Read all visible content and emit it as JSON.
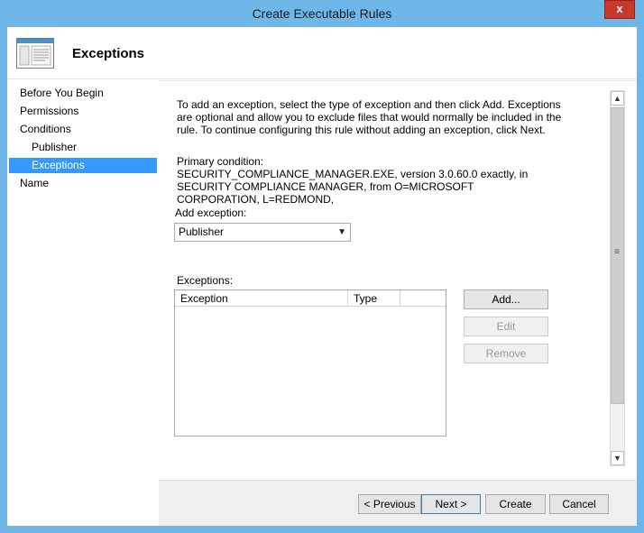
{
  "window": {
    "title": "Create Executable Rules",
    "close_glyph": "x"
  },
  "header": {
    "icon": "form-window-icon",
    "title": "Exceptions"
  },
  "nav": {
    "items": [
      {
        "label": "Before You Begin"
      },
      {
        "label": "Permissions"
      },
      {
        "label": "Conditions"
      },
      {
        "label": "Publisher"
      },
      {
        "label": "Exceptions"
      },
      {
        "label": "Name"
      }
    ],
    "selected": "Exceptions"
  },
  "content": {
    "intro": "To add an exception, select the type of exception and then click Add. Exceptions are optional and allow you to exclude files that would normally be included in the rule. To continue configuring this rule without adding an exception, click Next.",
    "primary_label": "Primary condition:",
    "primary_text": "SECURITY_COMPLIANCE_MANAGER.EXE, version 3.0.60.0 exactly, in SECURITY COMPLIANCE MANAGER, from O=MICROSOFT CORPORATION, L=REDMOND,",
    "add_exception_label": "Add exception:",
    "add_exception_value": "Publisher",
    "exceptions_label": "Exceptions:",
    "columns": [
      {
        "label": "Exception"
      },
      {
        "label": "Type"
      }
    ],
    "buttons": {
      "add": "Add...",
      "edit": "Edit",
      "remove": "Remove"
    }
  },
  "footer": {
    "previous": "< Previous",
    "next": "Next >",
    "create": "Create",
    "cancel": "Cancel"
  },
  "colors": {
    "titlebar": "#6fb7e8",
    "selection": "#3399ff",
    "close": "#c7392a"
  }
}
